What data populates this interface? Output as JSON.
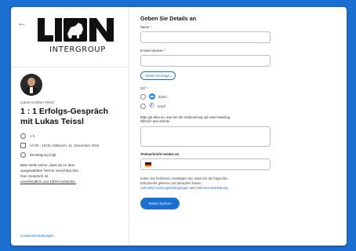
{
  "sidebar": {
    "back_icon": "arrow-left-icon",
    "logo_text": "LION",
    "logo_subtitle": "INTERGROUP",
    "host_name": "Lukas Günther Teissl",
    "event_title": "1 : 1 Erfolgs-Gespräch mit Lukas Teissl",
    "duration": "1 h",
    "datetime": "17:00 - 18:00, Mittwoch, 11. Dezember 2024",
    "confirm_text": "Bestätigung folgt",
    "desc_line1": "Bitte stelle sicher, dass du zu dem",
    "desc_line2": "ausgewählten Termin erreichbar bist.",
    "desc_line3": "Das Gespräch ist",
    "desc_line4": "unverbindlich und 100% kostenlos.",
    "cookie_link": "Cookie-Einstellungen"
  },
  "form": {
    "heading": "Geben Sie Details an",
    "name_label": "Name *",
    "email_label": "E-Mail-Adresse *",
    "add_guests": "Gäste hinzufügen",
    "location_label": "Ort *",
    "opt_zoom": "Zoom",
    "opt_call": "Anruf",
    "notes_label_line1": "Bitte gib alles an, was bei der Vorbereitung auf unser Meeting",
    "notes_label_line2": "hilfreich sein könnte.",
    "phone_label": "Textnachricht senden an",
    "legal_line1": "Indem Sie fortfahren, bestätigen Sie, dass Sie die folgenden",
    "legal_line2": "Dokumente gelesen und akzeptiert haben:",
    "legal_link": "Calendlys Nutzungsbedingungen",
    "legal_and": "und",
    "legal_link2": "Datenschutzerklärung.",
    "submit": "Termin buchen"
  },
  "colors": {
    "brand_blue": "#1b6fd1"
  }
}
